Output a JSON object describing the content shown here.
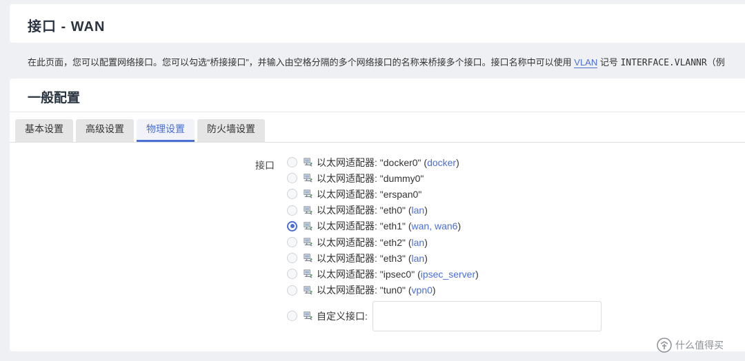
{
  "page": {
    "title": "接口 - WAN",
    "description": {
      "prefix": "在此页面，您可以配置网络接口。您可以勾选“桥接接口”，并输入由空格分隔的多个网络接口的名称来桥接多个接口。接口名称中可以使用 ",
      "link": "VLAN",
      "middle": " 记号 ",
      "code": "INTERFACE.VLANNR",
      "suffix": "（例"
    }
  },
  "section": {
    "title": "一般配置",
    "tabs": [
      {
        "label": "基本设置"
      },
      {
        "label": "高级设置"
      },
      {
        "label": "物理设置"
      },
      {
        "label": "防火墙设置"
      }
    ],
    "active_tab": "物理设置"
  },
  "interface_field": {
    "label": "接口",
    "options": [
      {
        "label": "以太网适配器: \"docker0\" (",
        "net": "docker",
        "close": ")",
        "checked": false
      },
      {
        "label": "以太网适配器: \"dummy0\"",
        "net": "",
        "close": "",
        "checked": false
      },
      {
        "label": "以太网适配器: \"erspan0\"",
        "net": "",
        "close": "",
        "checked": false
      },
      {
        "label": "以太网适配器: \"eth0\" (",
        "net": "lan",
        "close": ")",
        "checked": false
      },
      {
        "label": "以太网适配器: \"eth1\" (",
        "net": "wan, wan6",
        "close": ")",
        "checked": true
      },
      {
        "label": "以太网适配器: \"eth2\" (",
        "net": "lan",
        "close": ")",
        "checked": false
      },
      {
        "label": "以太网适配器: \"eth3\" (",
        "net": "lan",
        "close": ")",
        "checked": false
      },
      {
        "label": "以太网适配器: \"ipsec0\" (",
        "net": "ipsec_server",
        "close": ")",
        "checked": false
      },
      {
        "label": "以太网适配器: \"tun0\" (",
        "net": "vpn0",
        "close": ")",
        "checked": false
      }
    ],
    "custom": {
      "label": "自定义接口:",
      "value": ""
    }
  },
  "watermark": {
    "text": "什么值得买"
  },
  "colors": {
    "accent": "#4a6fd1",
    "background": "#eef0f4"
  }
}
